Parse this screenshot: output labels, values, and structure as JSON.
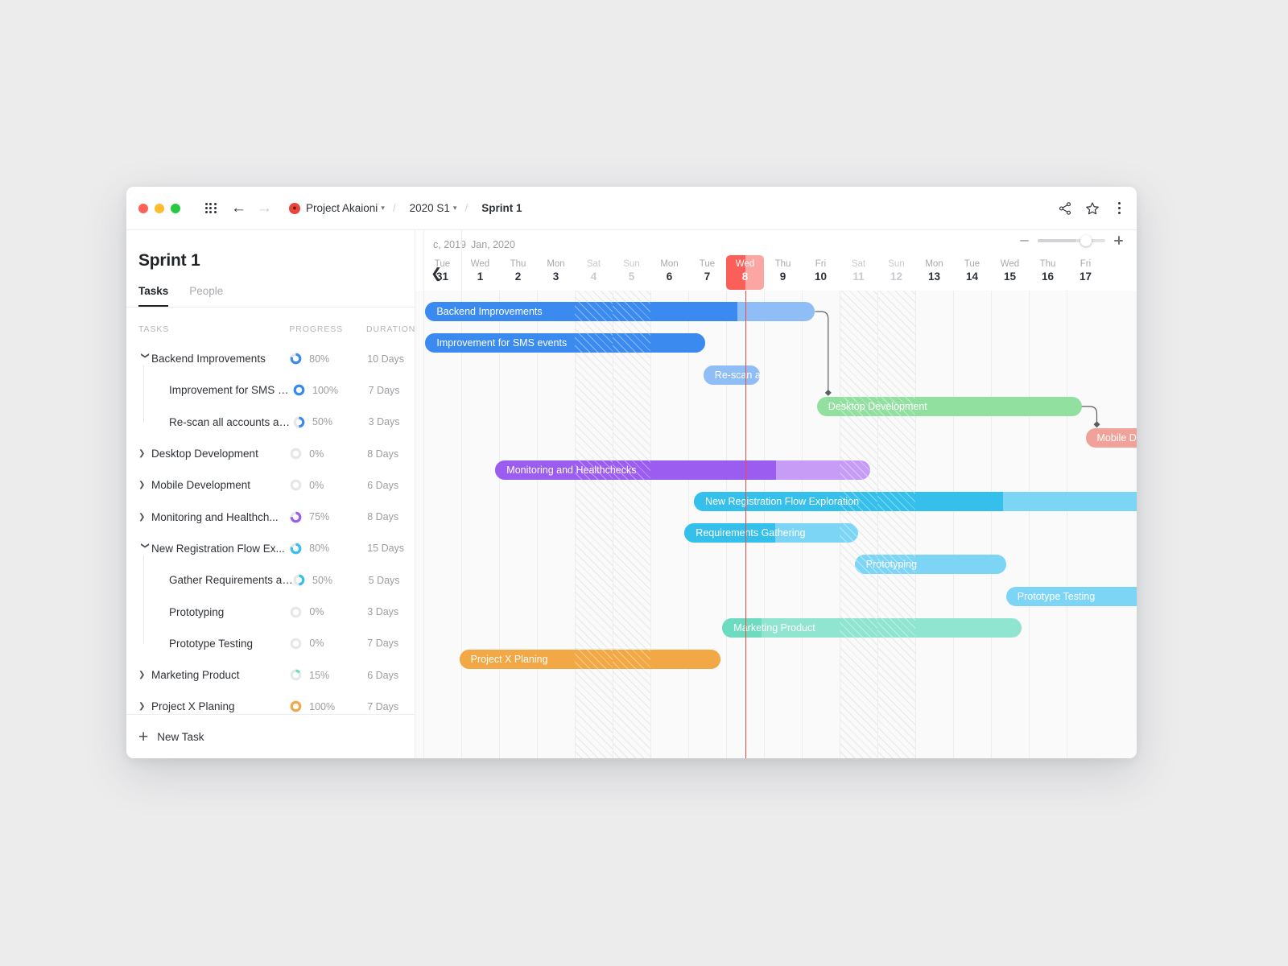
{
  "window": {
    "traffic_lights": [
      "close",
      "minimize",
      "maximize"
    ],
    "apps_grid_icon": "grid-dots-icon",
    "back_icon": "arrow-left-icon",
    "forward_icon": "arrow-right-icon",
    "project_avatar": "project-avatar-icon",
    "breadcrumb": {
      "project": "Project Akaioni",
      "period": "2020 S1",
      "current": "Sprint 1",
      "separator": "/"
    },
    "actions": {
      "share": "share-icon",
      "favorite": "star-icon",
      "more": "kebab-menu-icon"
    }
  },
  "left_panel": {
    "title": "Sprint 1",
    "tabs": [
      {
        "label": "Tasks",
        "active": true
      },
      {
        "label": "People",
        "active": false
      }
    ],
    "columns": {
      "tasks": "TASKS",
      "progress": "PROGRESS",
      "duration": "DURATION"
    },
    "rows": [
      {
        "name": "Backend Improvements",
        "progress": "80%",
        "progress_value": 80,
        "duration": "10 Days",
        "level": 0,
        "expanded": true,
        "color": "#3b8af0"
      },
      {
        "name": "Improvement for SMS ev...",
        "progress": "100%",
        "progress_value": 100,
        "duration": "7 Days",
        "level": 1,
        "expanded": null,
        "color": "#3b8af0"
      },
      {
        "name": "Re-scan all accounts ad...",
        "progress": "50%",
        "progress_value": 50,
        "duration": "3 Days",
        "level": 1,
        "expanded": null,
        "color": "#3b8af0"
      },
      {
        "name": "Desktop Development",
        "progress": "0%",
        "progress_value": 0,
        "duration": "8 Days",
        "level": 0,
        "expanded": false,
        "color": "#92e0a0"
      },
      {
        "name": "Mobile Development",
        "progress": "0%",
        "progress_value": 0,
        "duration": "6 Days",
        "level": 0,
        "expanded": false,
        "color": "#f0a199"
      },
      {
        "name": "Monitoring and Healthch...",
        "progress": "75%",
        "progress_value": 75,
        "duration": "8 Days",
        "level": 0,
        "expanded": false,
        "color": "#9b5cf0"
      },
      {
        "name": "New Registration Flow Ex...",
        "progress": "80%",
        "progress_value": 80,
        "duration": "15 Days",
        "level": 0,
        "expanded": true,
        "color": "#35c0ec"
      },
      {
        "name": "Gather Requirements an...",
        "progress": "50%",
        "progress_value": 50,
        "duration": "5 Days",
        "level": 1,
        "expanded": null,
        "color": "#35c0ec"
      },
      {
        "name": "Prototyping",
        "progress": "0%",
        "progress_value": 0,
        "duration": "3 Days",
        "level": 1,
        "expanded": null,
        "color": "#7dd5f5"
      },
      {
        "name": "Prototype Testing",
        "progress": "0%",
        "progress_value": 0,
        "duration": "7 Days",
        "level": 1,
        "expanded": null,
        "color": "#7dd5f5"
      },
      {
        "name": "Marketing Product",
        "progress": "15%",
        "progress_value": 15,
        "duration": "6 Days",
        "level": 0,
        "expanded": false,
        "color": "#6ddbc0"
      },
      {
        "name": "Project X Planing",
        "progress": "100%",
        "progress_value": 100,
        "duration": "7 Days",
        "level": 0,
        "expanded": false,
        "color": "#f2a945"
      }
    ],
    "footer": {
      "add_icon": "plus-icon",
      "add_label": "New Task"
    }
  },
  "timeline": {
    "prev_icon": "chevron-left-icon",
    "next_icon": "chevron-right-icon",
    "months": [
      {
        "label": "c, 2019",
        "start_index": 0,
        "span": 1
      },
      {
        "label": "Jan, 2020",
        "start_index": 1,
        "span": 18
      }
    ],
    "days": [
      {
        "dow": "Tue",
        "num": "31",
        "weekend": false,
        "today": false
      },
      {
        "dow": "Wed",
        "num": "1",
        "weekend": false,
        "today": false
      },
      {
        "dow": "Thu",
        "num": "2",
        "weekend": false,
        "today": false
      },
      {
        "dow": "Mon",
        "num": "3",
        "weekend": false,
        "today": false
      },
      {
        "dow": "Sat",
        "num": "4",
        "weekend": true,
        "today": false
      },
      {
        "dow": "Sun",
        "num": "5",
        "weekend": true,
        "today": false
      },
      {
        "dow": "Mon",
        "num": "6",
        "weekend": false,
        "today": false
      },
      {
        "dow": "Tue",
        "num": "7",
        "weekend": false,
        "today": false
      },
      {
        "dow": "Wed",
        "num": "8",
        "weekend": false,
        "today": true
      },
      {
        "dow": "Thu",
        "num": "9",
        "weekend": false,
        "today": false
      },
      {
        "dow": "Fri",
        "num": "10",
        "weekend": false,
        "today": false
      },
      {
        "dow": "Sat",
        "num": "11",
        "weekend": true,
        "today": false
      },
      {
        "dow": "Sun",
        "num": "12",
        "weekend": true,
        "today": false
      },
      {
        "dow": "Mon",
        "num": "13",
        "weekend": false,
        "today": false
      },
      {
        "dow": "Tue",
        "num": "14",
        "weekend": false,
        "today": false
      },
      {
        "dow": "Wed",
        "num": "15",
        "weekend": false,
        "today": false
      },
      {
        "dow": "Thu",
        "num": "16",
        "weekend": false,
        "today": false
      },
      {
        "dow": "Fri",
        "num": "17",
        "weekend": false,
        "today": false
      }
    ],
    "zoom": {
      "minus_icon": "minus-icon",
      "plus_icon": "plus-icon",
      "value_percent": 63
    },
    "today_marker": {
      "day": "8",
      "color": "#fa5f5a"
    },
    "bars": [
      {
        "task": "Backend Improvements",
        "row": 0,
        "start_day": 0.05,
        "end_day": 10.35,
        "progress": 80,
        "color": "#3b8af0",
        "light": "#8fbdf5",
        "show_label": true
      },
      {
        "task": "Improvement for SMS events",
        "row": 1,
        "start_day": 0.05,
        "end_day": 7.45,
        "progress": 100,
        "color": "#3b8af0",
        "light": "#8fbdf5",
        "show_label": true
      },
      {
        "task": "Re-scan all account...",
        "row": 2,
        "start_day": 7.4,
        "end_day": 8.9,
        "progress": 100,
        "color": "#8fbdf5",
        "light": "#8fbdf5",
        "show_label": true
      },
      {
        "task": "Desktop Development",
        "row": 3,
        "start_day": 10.4,
        "end_day": 17.4,
        "progress": 0,
        "color": "#92e0a0",
        "light": "#92e0a0",
        "show_label": true
      },
      {
        "task": "Mobile Development",
        "row": 4,
        "start_day": 17.5,
        "end_day": 23.0,
        "progress": 0,
        "color": "#f0a199",
        "light": "#f0a199",
        "show_label": true
      },
      {
        "task": "Monitoring and Healthchecks",
        "row": 5,
        "start_day": 1.9,
        "end_day": 11.8,
        "progress": 75,
        "color": "#9b5cf0",
        "light": "#c69cf7",
        "show_label": true
      },
      {
        "task": "New Registration Flow Exploration",
        "row": 6,
        "start_day": 7.15,
        "end_day": 22.0,
        "progress": 55,
        "color": "#35c0ec",
        "light": "#7dd5f5",
        "show_label": true
      },
      {
        "task": "Requirements Gathering",
        "row": 7,
        "start_day": 6.9,
        "end_day": 11.5,
        "progress": 52,
        "color": "#35c0ec",
        "light": "#7dd5f5",
        "show_label": true
      },
      {
        "task": "Prototyping",
        "row": 8,
        "start_day": 11.4,
        "end_day": 15.4,
        "progress": 0,
        "color": "#7dd5f5",
        "light": "#7dd5f5",
        "show_label": true
      },
      {
        "task": "Prototype Testing",
        "row": 9,
        "start_day": 15.4,
        "end_day": 22.0,
        "progress": 0,
        "color": "#7dd5f5",
        "light": "#7dd5f5",
        "show_label": true
      },
      {
        "task": "Marketing Product",
        "row": 10,
        "start_day": 7.9,
        "end_day": 15.8,
        "progress": 13,
        "color": "#6ddbc0",
        "light": "#8fe5d0",
        "show_label": true
      },
      {
        "task": "Project X Planing",
        "row": 11,
        "start_day": 0.95,
        "end_day": 7.85,
        "progress": 100,
        "color": "#f2a945",
        "light": "#f2a945",
        "show_label": true
      }
    ],
    "dependencies": [
      {
        "from_row": 0,
        "to_row": 3,
        "label": "backend-to-desktop"
      },
      {
        "from_row": 3,
        "to_row": 4,
        "label": "desktop-to-mobile"
      }
    ]
  }
}
